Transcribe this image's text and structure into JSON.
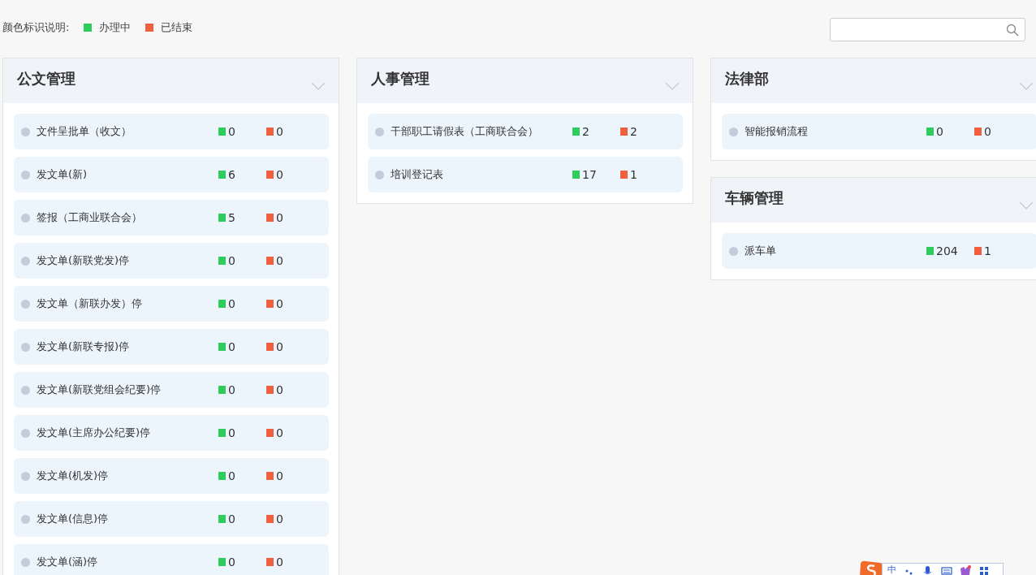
{
  "legend": {
    "label": "颜色标识说明:",
    "items": [
      {
        "label": "办理中",
        "color": "#2ecc5a"
      },
      {
        "label": "已结束",
        "color": "#f0603e"
      }
    ]
  },
  "columns": [
    {
      "panels": [
        {
          "title": "公文管理",
          "items": [
            {
              "name": "文件呈批单（收文）",
              "in_progress": "0",
              "finished": "0"
            },
            {
              "name": "发文单(新)",
              "in_progress": "6",
              "finished": "0"
            },
            {
              "name": "签报（工商业联合会）",
              "in_progress": "5",
              "finished": "0"
            },
            {
              "name": "发文单(新联党发)停",
              "in_progress": "0",
              "finished": "0"
            },
            {
              "name": "发文单（新联办发）停",
              "in_progress": "0",
              "finished": "0"
            },
            {
              "name": "发文单(新联专报)停",
              "in_progress": "0",
              "finished": "0"
            },
            {
              "name": "发文单(新联党组会纪要)停",
              "in_progress": "0",
              "finished": "0"
            },
            {
              "name": "发文单(主席办公纪要)停",
              "in_progress": "0",
              "finished": "0"
            },
            {
              "name": "发文单(机发)停",
              "in_progress": "0",
              "finished": "0"
            },
            {
              "name": "发文单(信息)停",
              "in_progress": "0",
              "finished": "0"
            },
            {
              "name": "发文单(涵)停",
              "in_progress": "0",
              "finished": "0"
            }
          ]
        }
      ]
    },
    {
      "panels": [
        {
          "title": "人事管理",
          "items": [
            {
              "name": "干部职工请假表（工商联合会）",
              "in_progress": "2",
              "finished": "2"
            },
            {
              "name": "培训登记表",
              "in_progress": "17",
              "finished": "1"
            }
          ]
        }
      ]
    },
    {
      "panels": [
        {
          "title": "法律部",
          "items": [
            {
              "name": "智能报销流程",
              "in_progress": "0",
              "finished": "0"
            }
          ]
        },
        {
          "title": "车辆管理",
          "items": [
            {
              "name": "派车单",
              "in_progress": "204",
              "finished": "1"
            }
          ]
        }
      ]
    }
  ],
  "ime_toolbar": {
    "mode": "中"
  }
}
